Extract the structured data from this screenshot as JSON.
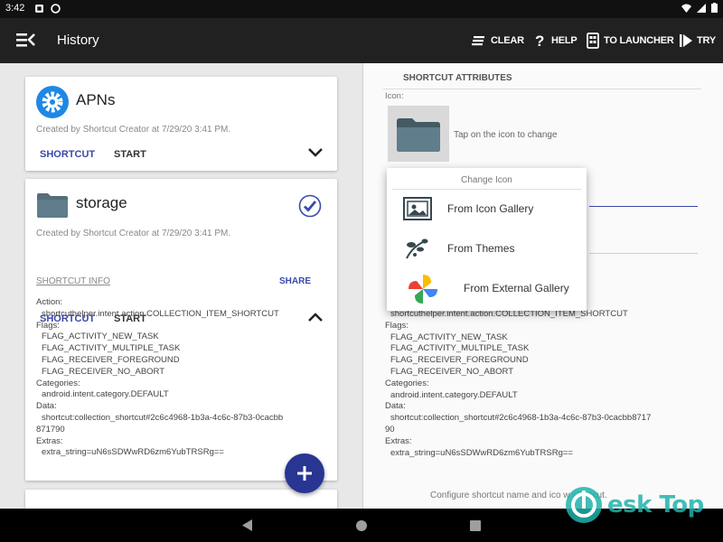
{
  "status_bar": {
    "time": "3:42"
  },
  "app_bar": {
    "title": "History",
    "actions": {
      "clear": "CLEAR",
      "help": "HELP",
      "to_launcher": "TO LAUNCHER",
      "try": "TRY"
    }
  },
  "history": {
    "cards": [
      {
        "title": "APNs",
        "created": "Created by Shortcut Creator at 7/29/20 3:41 PM.",
        "shortcut_btn": "SHORTCUT",
        "start_btn": "START",
        "icon": "gear-icon",
        "expanded": false
      },
      {
        "title": "storage",
        "created": "Created by Shortcut Creator at 7/29/20 3:41 PM.",
        "shortcut_btn": "SHORTCUT",
        "start_btn": "START",
        "icon": "folder-icon",
        "expanded": true,
        "info_link": "SHORTCUT INFO",
        "share": "SHARE",
        "action_label": "Action:",
        "action_value": "shortcuthelper.intent.action.COLLECTION_ITEM_SHORTCUT",
        "flags_label": "Flags:",
        "flags": [
          "FLAG_ACTIVITY_NEW_TASK",
          "FLAG_ACTIVITY_MULTIPLE_TASK",
          "FLAG_RECEIVER_FOREGROUND",
          "FLAG_RECEIVER_NO_ABORT"
        ],
        "categories_label": "Categories:",
        "category": "android.intent.category.DEFAULT",
        "data_label": "Data:",
        "data_value_1": "shortcut:collection_shortcut#2c6c4968-1b3a-4c6c-87b3-0cacbb",
        "data_value_2": "871790",
        "extras_label": "Extras:",
        "extras_value": "extra_string=uN6sSDWwRD6zm6YubTRSRg=="
      }
    ]
  },
  "attributes": {
    "header": "SHORTCUT ATTRIBUTES",
    "icon_label": "Icon:",
    "tap_hint": "Tap on the icon to change",
    "action_value": "shortcuthelper.intent.action.COLLECTION_ITEM_SHORTCUT",
    "flags_label": "Flags:",
    "flags": [
      "FLAG_ACTIVITY_NEW_TASK",
      "FLAG_ACTIVITY_MULTIPLE_TASK",
      "FLAG_RECEIVER_FOREGROUND",
      "FLAG_RECEIVER_NO_ABORT"
    ],
    "categories_label": "Categories:",
    "category": "android.intent.category.DEFAULT",
    "data_label": "Data:",
    "data_value_1": "shortcut:collection_shortcut#2c6c4968-1b3a-4c6c-87b3-0cacbb8717",
    "data_value_2": "90",
    "extras_label": "Extras:",
    "extras_value": "extra_string=uN6sSDWwRD6zm6YubTRSRg==",
    "bottom_hint": "Configure shortcut name and ico          w shortcut."
  },
  "change_icon_dialog": {
    "title": "Change Icon",
    "items": [
      {
        "label": "From Icon Gallery",
        "icon": "gallery-icon"
      },
      {
        "label": "From Themes",
        "icon": "themes-icon"
      },
      {
        "label": "From External Gallery",
        "icon": "pinwheel-icon"
      }
    ]
  },
  "watermark": {
    "text": "esk Top"
  },
  "colors": {
    "accent": "#3949ab",
    "appbar": "#212121",
    "fab": "#283593",
    "gear": "#1e88e5"
  }
}
